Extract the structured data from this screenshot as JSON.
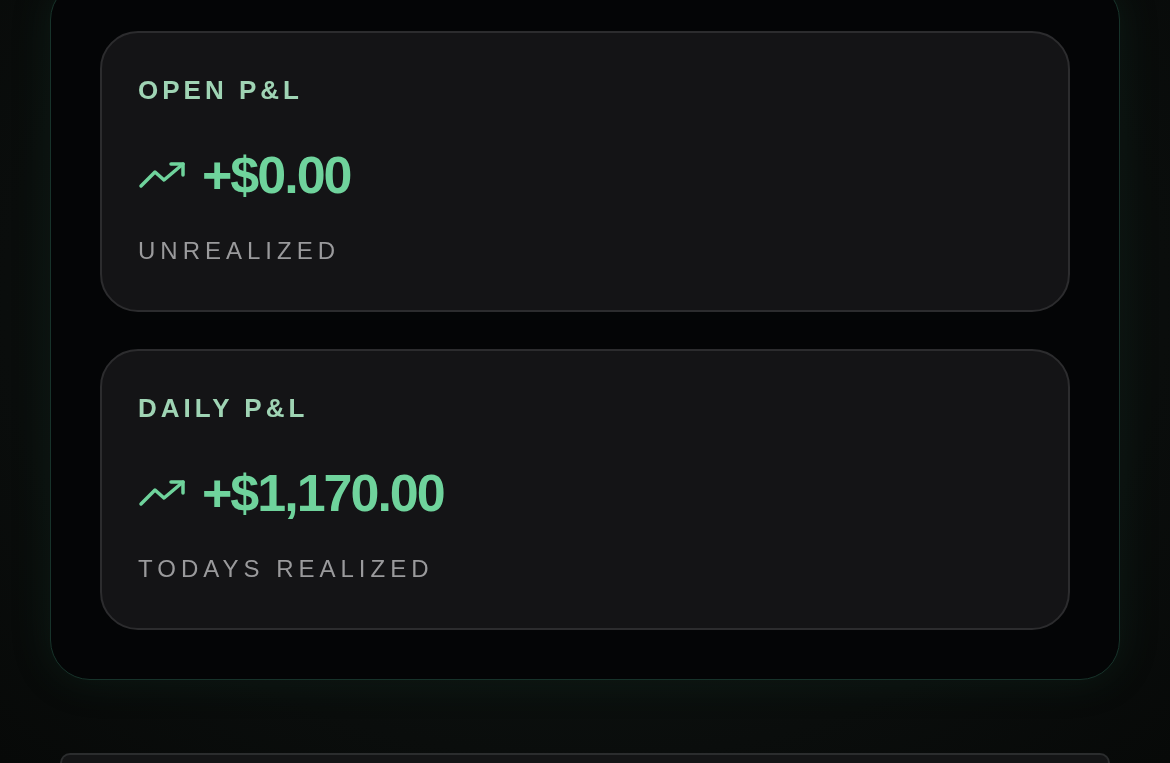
{
  "cards": [
    {
      "title": "OPEN P&L",
      "kind": "up",
      "value": "+$0.00",
      "caption": "UNREALIZED"
    },
    {
      "title": "DAILY P&L",
      "kind": "up",
      "value": "+$1,170.00",
      "caption": "TODAYS REALIZED"
    }
  ]
}
